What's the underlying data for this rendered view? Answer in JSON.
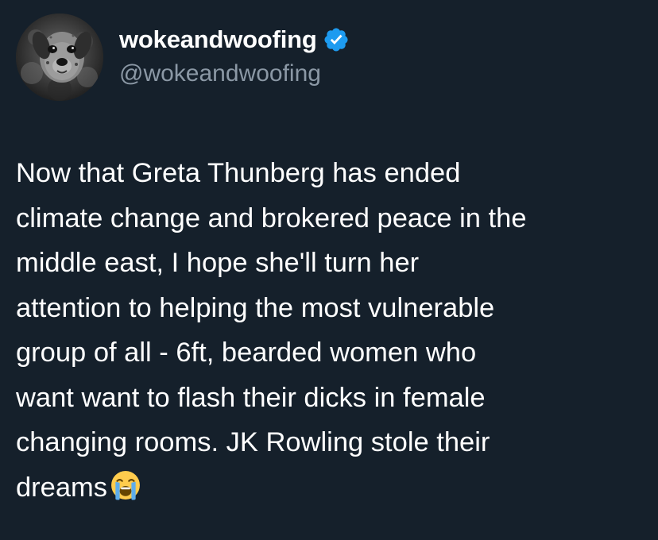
{
  "author": {
    "display_name": "wokeandwoofing",
    "handle": "@wokeandwoofing",
    "verified": true,
    "verified_color": "#1d9bf0",
    "avatar_icon": "dog-photo-avatar"
  },
  "tweet": {
    "lines": [
      "Now that Greta Thunberg has ended",
      "climate change and brokered peace in the",
      "middle east, I hope she'll turn her",
      "attention to helping the most vulnerable",
      "group of all - 6ft, bearded women who",
      "want want to flash their dicks in female",
      "changing rooms. JK Rowling stole their",
      "dreams"
    ],
    "trailing_emoji": "loudly-crying-face-emoji"
  },
  "theme": {
    "background": "#15202b",
    "text": "#ffffff",
    "secondary_text": "#8b98a5"
  }
}
